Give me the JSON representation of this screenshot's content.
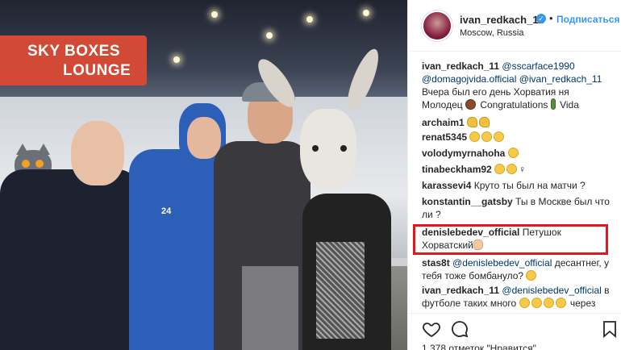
{
  "photo": {
    "sign_line1": "SKY BOXES",
    "sign_line2": "LOUNGE",
    "shirt_number": "24"
  },
  "header": {
    "username": "ivan_redkach_11",
    "verified_mark": "✓",
    "separator": "•",
    "follow_label": "Подписаться",
    "location": "Moscow, Russia"
  },
  "comments": [
    {
      "user": "ivan_redkach_11",
      "parts": [
        "@sscarface1990",
        "@domagojvida.official @ivan_redkach_11",
        "Вчера был его день Хорватия ня",
        "Молодец",
        "Congratulations",
        "Vida"
      ]
    },
    {
      "user": "archaim1",
      "text": ""
    },
    {
      "user": "renat5345",
      "text": ""
    },
    {
      "user": "volodymyrnahoha",
      "text": ""
    },
    {
      "user": "tinabeckham92",
      "text": "♀"
    },
    {
      "user": "karassevi4",
      "text": "Круто ты был на матчи ?"
    },
    {
      "user": "konstantin__gatsby",
      "text": "Ты в Москве был что",
      "text2": "ли ?"
    },
    {
      "user": "denislebedev_official",
      "text": "Петушок",
      "text2": "Хорватский"
    },
    {
      "user": "stas8t",
      "mention": "@denislebedev_official",
      "text": "десантнег, у",
      "text2": "тебя тоже бомбануло?"
    },
    {
      "user": "ivan_redkach_11",
      "mention": "@denislebedev_official",
      "text": "в",
      "text2": "футболе таких много",
      "text3": "через"
    }
  ],
  "footer": {
    "likes_text": "1 378 отметок \"Нравится\""
  },
  "icons": [
    "heart-icon",
    "comment-icon",
    "bookmark-icon"
  ],
  "colors": {
    "link": "#003569",
    "follow": "#3897f0",
    "highlight": "#e3181f",
    "sign": "#d24a35"
  }
}
